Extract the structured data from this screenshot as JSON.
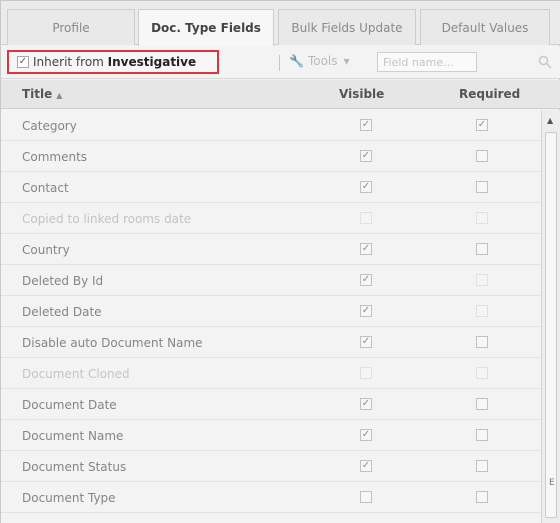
{
  "tabs": [
    {
      "label": "Profile"
    },
    {
      "label": "Doc. Type Fields"
    },
    {
      "label": "Bulk Fields Update"
    },
    {
      "label": "Default Values"
    }
  ],
  "toolbar": {
    "inherit_prefix": "Inherit from ",
    "inherit_source": "Investigative",
    "inherit_checked": "✓",
    "tools_label": "Tools",
    "field_name_placeholder": "Field name..."
  },
  "columns": {
    "title": "Title",
    "visible": "Visible",
    "required": "Required"
  },
  "rows": [
    {
      "title": "Category",
      "visible": "✓",
      "required": "✓"
    },
    {
      "title": "Comments",
      "visible": "✓",
      "required": ""
    },
    {
      "title": "Contact",
      "visible": "✓",
      "required": ""
    },
    {
      "title": "Copied to linked rooms date",
      "visible": "",
      "required": ""
    },
    {
      "title": "Country",
      "visible": "✓",
      "required": ""
    },
    {
      "title": "Deleted By Id",
      "visible": "✓",
      "required": ""
    },
    {
      "title": "Deleted Date",
      "visible": "✓",
      "required": ""
    },
    {
      "title": "Disable auto Document Name",
      "visible": "✓",
      "required": ""
    },
    {
      "title": "Document Cloned",
      "visible": "",
      "required": ""
    },
    {
      "title": "Document Date",
      "visible": "✓",
      "required": ""
    },
    {
      "title": "Document Name",
      "visible": "✓",
      "required": ""
    },
    {
      "title": "Document Status",
      "visible": "✓",
      "required": ""
    },
    {
      "title": "Document Type",
      "visible": "",
      "required": ""
    }
  ]
}
